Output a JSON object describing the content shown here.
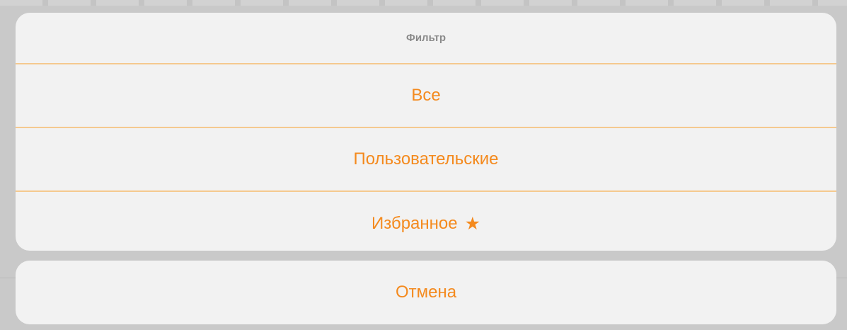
{
  "action_sheet": {
    "title": "Фильтр",
    "options": [
      {
        "label": "Все"
      },
      {
        "label": "Пользовательские"
      },
      {
        "label": "Избранное",
        "icon": "star-icon"
      }
    ],
    "cancel_label": "Отмена"
  },
  "colors": {
    "accent": "#f48a1e",
    "separator": "#f5c98f",
    "sheet_background": "#f2f2f2",
    "title_text": "#8a8a8a",
    "backdrop": "#c9c9c9"
  }
}
